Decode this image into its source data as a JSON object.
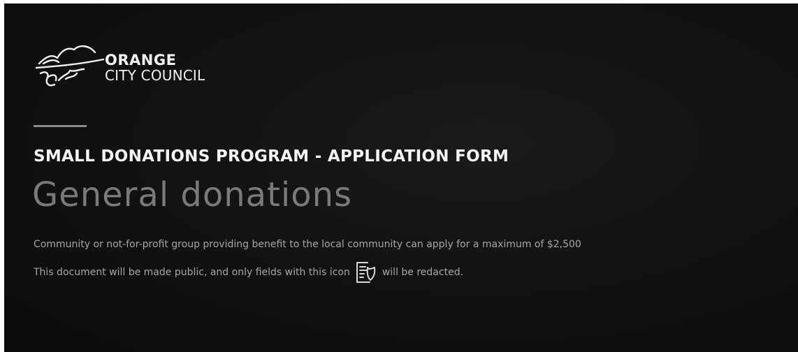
{
  "logo": {
    "line1": "ORANGE",
    "line2": "CITY COUNCIL",
    "icon": "orange-city-council-logo-icon"
  },
  "header": {
    "program_title": "SMALL DONATIONS PROGRAM - APPLICATION FORM",
    "subtitle": "General donations"
  },
  "intro_text": "Community or not-for-profit group providing benefit to the local community can apply for a maximum of $2,500",
  "notice": {
    "before_icon": "This document will be made public, and only fields with this icon",
    "icon": "redacted-document-icon",
    "after_icon": "will be redacted."
  },
  "colors": {
    "background": "#111111",
    "title": "#f5f5f5",
    "subtitle": "#7a7a7a",
    "body_text": "#a6a6a6"
  }
}
